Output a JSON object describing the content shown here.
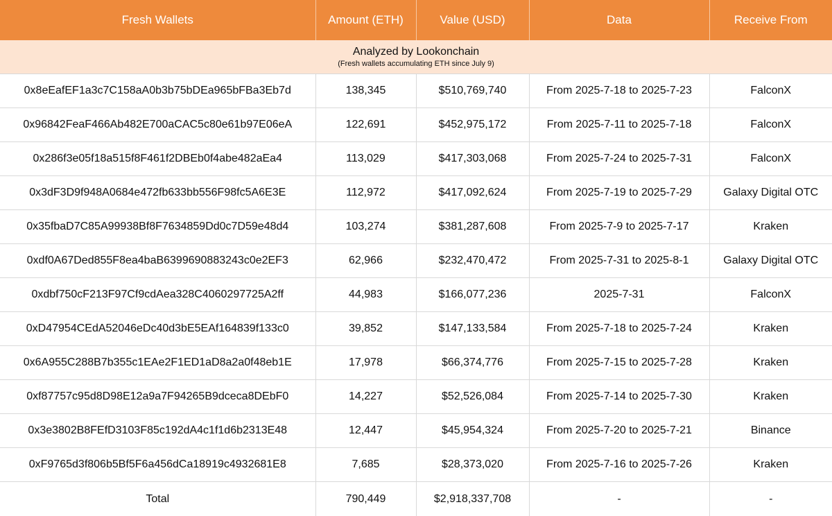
{
  "chart_data": {
    "type": "table",
    "title": "Analyzed by Lookonchain",
    "subtitle": "(Fresh wallets accumulating ETH since July 9)",
    "columns": [
      "Fresh Wallets",
      "Amount (ETH)",
      "Value (USD)",
      "Data",
      "Receive From"
    ],
    "rows": [
      [
        "0x8eEafEF1a3c7C158aA0b3b75bDEa965bFBa3Eb7d",
        "138,345",
        "$510,769,740",
        "From 2025-7-18 to 2025-7-23",
        "FalconX"
      ],
      [
        "0x96842FeaF466Ab482E700aCAC5c80e61b97E06eA",
        "122,691",
        "$452,975,172",
        "From 2025-7-11 to 2025-7-18",
        "FalconX"
      ],
      [
        "0x286f3e05f18a515f8F461f2DBEb0f4abe482aEa4",
        "113,029",
        "$417,303,068",
        "From 2025-7-24 to 2025-7-31",
        "FalconX"
      ],
      [
        "0x3dF3D9f948A0684e472fb633bb556F98fc5A6E3E",
        "112,972",
        "$417,092,624",
        "From 2025-7-19 to 2025-7-29",
        "Galaxy Digital OTC"
      ],
      [
        "0x35fbaD7C85A99938Bf8F7634859Dd0c7D59e48d4",
        "103,274",
        "$381,287,608",
        "From 2025-7-9 to 2025-7-17",
        "Kraken"
      ],
      [
        "0xdf0A67Ded855F8ea4baB6399690883243c0e2EF3",
        "62,966",
        "$232,470,472",
        "From 2025-7-31 to 2025-8-1",
        "Galaxy Digital OTC"
      ],
      [
        "0xdbf750cF213F97Cf9cdAea328C4060297725A2ff",
        "44,983",
        "$166,077,236",
        "2025-7-31",
        "FalconX"
      ],
      [
        "0xD47954CEdA52046eDc40d3bE5EAf164839f133c0",
        "39,852",
        "$147,133,584",
        "From 2025-7-18 to 2025-7-24",
        "Kraken"
      ],
      [
        "0x6A955C288B7b355c1EAe2F1ED1aD8a2a0f48eb1E",
        "17,978",
        "$66,374,776",
        "From 2025-7-15 to 2025-7-28",
        "Kraken"
      ],
      [
        "0xf87757c95d8D98E12a9a7F94265B9dceca8DEbF0",
        "14,227",
        "$52,526,084",
        "From 2025-7-14 to 2025-7-30",
        "Kraken"
      ],
      [
        "0x3e3802B8FEfD3103F85c192dA4c1f1d6b2313E48",
        "12,447",
        "$45,954,324",
        "From 2025-7-20 to 2025-7-21",
        "Binance"
      ],
      [
        "0xF9765d3f806b5Bf5F6a456dCa18919c4932681E8",
        "7,685",
        "$28,373,020",
        "From 2025-7-16 to 2025-7-26",
        "Kraken"
      ]
    ],
    "total": [
      "Total",
      "790,449",
      "$2,918,337,708",
      "-",
      "-"
    ],
    "colors": {
      "header_bg": "#ee8a3c",
      "header_text": "#ffffff",
      "banner_bg": "#fde4d2",
      "grid": "#d9d9d9"
    }
  }
}
